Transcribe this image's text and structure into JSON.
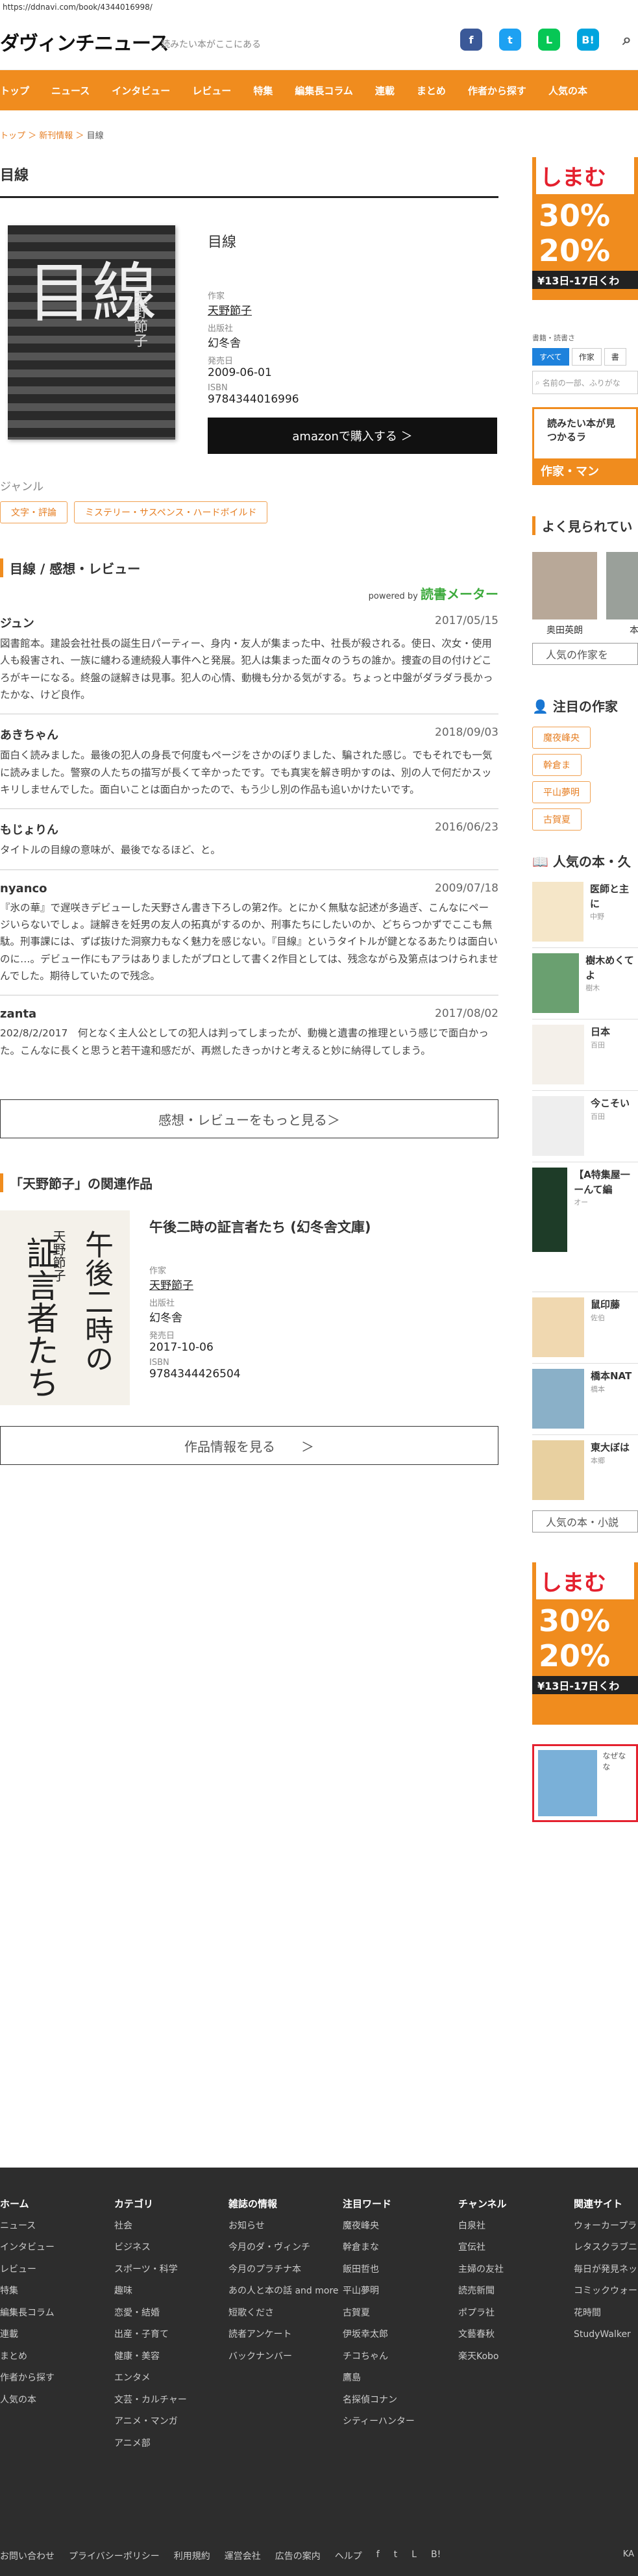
{
  "url": "https://ddnavi.com/book/4344016998/",
  "site": {
    "logo": "ダヴィンチニュース",
    "tagline": "読みたい本がここにある"
  },
  "social": [
    {
      "name": "facebook-icon",
      "glyph": "f",
      "color": "#3b5998"
    },
    {
      "name": "twitter-icon",
      "glyph": "t",
      "color": "#1da1f2"
    },
    {
      "name": "line-icon",
      "glyph": "L",
      "color": "#06c755"
    },
    {
      "name": "hatena-icon",
      "glyph": "B!",
      "color": "#00a4de"
    },
    {
      "name": "search-icon",
      "glyph": "⌕",
      "color": "#555"
    }
  ],
  "nav": [
    "トップ",
    "ニュース",
    "インタビュー",
    "レビュー",
    "特集",
    "編集長コラム",
    "連載",
    "まとめ",
    "作者から探す",
    "人気の本"
  ],
  "breadcrumb": {
    "home": "トップ",
    "cat": "新刊情報",
    "current": "目線"
  },
  "page_title": "目線",
  "book": {
    "cover_title": "目線",
    "cover_author": "天野節子",
    "title": "目線",
    "author_label": "作家",
    "author": "天野節子",
    "publisher_label": "出版社",
    "publisher": "幻冬舎",
    "date_label": "発売日",
    "date": "2009-06-01",
    "isbn_label": "ISBN",
    "isbn": "9784344016996",
    "amazon": "amazonで購入する ＞"
  },
  "genre": {
    "heading": "ジャンル",
    "tags": [
      "文字・評論",
      "ミステリー・サスペンス・ハードボイルド"
    ]
  },
  "reviews": {
    "heading": "目線 / 感想・レビュー",
    "powered": "powered by",
    "powered_brand": "読書メーター",
    "more": "感想・レビューをもっと見る＞",
    "items": [
      {
        "user": "ジュン",
        "date": "2017/05/15",
        "text": "図書館本。建設会社社長の誕生日パーティー、身内・友人が集まった中、社長が殺される。使日、次女・使用人も殺害され、一族に纏わる連続殺人事件へと発展。犯人は集まった面々のうちの誰か。捜査の目の付けどころがキーになる。終盤の謎解きは見事。犯人の心情、動機も分かる気がする。ちょっと中盤がダラダラ長かったかな、けど良作。"
      },
      {
        "user": "あきちゃん",
        "date": "2018/09/03",
        "text": "面白く読みました。最後の犯人の身長で何度もページをさかのぼりました、騙された感じ。でもそれでも一気に読みました。警察の人たちの描写が長くて辛かったです。でも真実を解き明かすのは、別の人で何だかスッキリしませんでした。面白いことは面白かったので、もう少し別の作品も追いかけたいです。"
      },
      {
        "user": "もじょりん",
        "date": "2016/06/23",
        "text": "タイトルの目線の意味が、最後でなるほど、と。"
      },
      {
        "user": "nyanco",
        "date": "2009/07/18",
        "text": "『氷の華』で遅咲きデビューした天野さん書き下ろしの第2作。とにかく無駄な記述が多過ぎ、こんなにページいらないでしょ。謎解きを妊男の友人の拓真がするのか、刑事たちにしたいのか、どちらつかずでここも無駄。刑事課には、ずば抜けた洞察力もなく魅力を感じない。『目線』というタイトルが鍵となるあたりは面白いのに…。デビュー作にもアラはありましたがプロとして書く2作目としては、残念ながら及第点はつけられませんでした。期待していたので残念。"
      },
      {
        "user": "zanta",
        "date": "2017/08/02",
        "text": "202/8/2/2017　何となく主人公としての犯人は判ってしまったが、動機と遺書の推理という感じで面白かった。こんなに長くと思うと若干違和感だが、再燃したきっかけと考えると妙に納得してしまう。"
      }
    ]
  },
  "related": {
    "heading": "「天野節子」の関連作品",
    "cover_title_1": "午後二時の",
    "cover_title_2": "証言者たち",
    "cover_author": "天野節子",
    "title": "午後二時の証言者たち (幻冬舎文庫)",
    "author_label": "作家",
    "author": "天野節子",
    "publisher_label": "出版社",
    "publisher": "幻冬舎",
    "date_label": "発売日",
    "date": "2017-10-06",
    "isbn_label": "ISBN",
    "isbn": "9784344426504",
    "more": "作品情報を見る　　＞"
  },
  "side": {
    "ad_brand": "しまむ",
    "ad_off1": "30%",
    "ad_off2": "20%",
    "ad_dates": "¥13日-17日くわ",
    "search_caption": "書籍・読書さ",
    "tabs": [
      "すべて",
      "作家",
      "書"
    ],
    "search_placeholder": "名前の一部、ふりがな",
    "promo": "読みたい本が見つかるラ",
    "promo_btn": "作家・マン",
    "popular_authors": "よく見られてい",
    "authors": [
      "奥田英朗",
      "本谷"
    ],
    "authors_btn": "人気の作家を",
    "attention": "注目の作家",
    "attention_tags": [
      "魔夜峰央",
      "幹倉ま",
      "平山夢明",
      "古賀夏"
    ],
    "popular_books": "人気の本・久",
    "books": [
      {
        "title": "医師と主に",
        "sub": "中野"
      },
      {
        "title": "樹木めくてよ",
        "sub": "樹木"
      },
      {
        "title": "日本",
        "sub": "百田"
      },
      {
        "title": "今こそい",
        "sub": "百田"
      },
      {
        "title": "【A特集屋一ーんて編",
        "sub": "オー"
      },
      {
        "title": "鼠印藤",
        "sub": "佐伯"
      },
      {
        "title": "橋本NAT",
        "sub": "橋本"
      },
      {
        "title": "東大ぼは",
        "sub": "本郷"
      }
    ],
    "books_btn": "人気の本・小説",
    "ad2_text": "なぜなな"
  },
  "footer": {
    "cols": [
      {
        "title": "ホーム",
        "items": [
          "ニュース",
          "インタビュー",
          "レビュー",
          "特集",
          "編集長コラム",
          "連載",
          "まとめ",
          "作者から探す",
          "人気の本"
        ]
      },
      {
        "title": "カテゴリ",
        "items": [
          "社会",
          "ビジネス",
          "スポーツ・科学",
          "趣味",
          "恋愛・結婚",
          "出産・子育て",
          "健康・美容",
          "エンタメ",
          "文芸・カルチャー",
          "アニメ・マンガ",
          "アニメ部"
        ]
      },
      {
        "title": "雑誌の情報",
        "items": [
          "お知らせ",
          "今月のダ・ヴィンチ",
          "今月のプラチナ本",
          "あの人と本の話 and more",
          "短歌くださ",
          "読者アンケート",
          "バックナンバー"
        ]
      },
      {
        "title": "注目ワード",
        "items": [
          "魔夜峰央",
          "幹倉まな",
          "飯田哲也",
          "平山夢明",
          "古賀夏",
          "伊坂幸太郎",
          "チコちゃん",
          "鷹島",
          "名探偵コナン",
          "シティーハンター"
        ]
      },
      {
        "title": "チャンネル",
        "items": [
          "白泉社",
          "宣伝社",
          "主婦の友社",
          "読売新聞",
          "ポプラ社",
          "文藝春秋",
          "楽天Kobo"
        ]
      },
      {
        "title": "関連サイト",
        "items": [
          "ウォーカープラ",
          "レタスクラブニ",
          "毎日が発見ネット",
          "コミックウォーカー",
          "花時間",
          "StudyWalker"
        ]
      }
    ],
    "bottom": [
      "お問い合わせ",
      "プライバシーポリシー",
      "利用規約",
      "運営会社",
      "広告の案内",
      "ヘルプ"
    ],
    "copy": "KA"
  }
}
